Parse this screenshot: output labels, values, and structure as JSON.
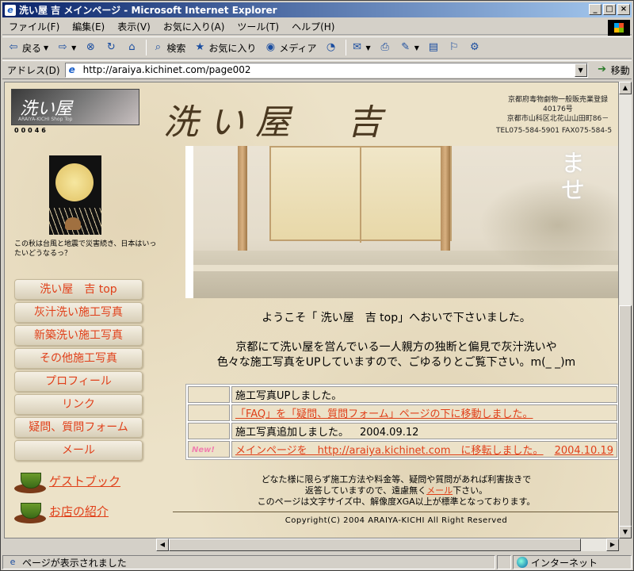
{
  "window": {
    "title": "洗い屋 吉 メインページ - Microsoft Internet Explorer",
    "controls": [
      "_",
      "□",
      "×"
    ]
  },
  "menu": [
    "ファイル(F)",
    "編集(E)",
    "表示(V)",
    "お気に入り(A)",
    "ツール(T)",
    "ヘルプ(H)"
  ],
  "toolbar": {
    "back": "戻る",
    "search": "検索",
    "favorites": "お気に入り",
    "media": "メディア"
  },
  "address": {
    "label": "アドレス(D)",
    "url": "http://araiya.kichinet.com/page002",
    "go": "移動"
  },
  "page": {
    "logo_text": "洗い屋",
    "logo_sub": "ARAIYA-KICHI  Shop Top",
    "counter": "00046",
    "title": "洗い屋　吉",
    "address_lines": [
      "京都府毒物劇物一般販売業登録",
      "40176号",
      "京都市山科区北花山山田町86－"
    ],
    "tel": "TEL075-584-5901 FAX075-584-5",
    "photo_kana": "ま\nせ",
    "moon_note": "この秋は台風と地震で災害続き、日本はいったいどうなるっ？",
    "nav": [
      "洗い屋　吉 top",
      "灰汁洗い施工写真",
      "新築洗い施工写真",
      "その他施工写真",
      "プロフィール",
      "リンク",
      "疑問、質問フォーム",
      "メール"
    ],
    "guestbook": "ゲストブック",
    "shop_intro": "お店の紹介",
    "welcome": "ようこそ「 洗い屋　吉 top」へおいで下さいました。",
    "intro_1": "京都にて洗い屋を営んでいる一人親方の独断と偏見で灰汁洗いや",
    "intro_2": "色々な施工写真をUPしていますので、ごゆるりとご覧下さい。m(_ _)m",
    "news": [
      {
        "badge": "",
        "text": "施工写真UPしました。",
        "date": "",
        "link": false
      },
      {
        "badge": "",
        "text": "「FAQ」を「疑問、質問フォーム」ページの下に移動しました。",
        "date": "",
        "link": true
      },
      {
        "badge": "",
        "text": "施工写真追加しました。",
        "date": "2004.09.12",
        "link": false
      },
      {
        "badge": "New!",
        "text": "メインページを　http://araiya.kichinet.com　に移転しました。",
        "date": "2004.10.19",
        "link": true
      }
    ],
    "footer_1": "どなた様に限らず施工方法や料金等、疑問や質問があれば利害抜きで",
    "footer_2a": "返答していますので、遠慮無く",
    "footer_mail": "メール",
    "footer_2b": "下さい。",
    "footer_3": "このページは文字サイズ中、解像度XGA以上が標準となっております。",
    "copyright": "Copyright(C) 2004 ARAIYA-KICHI All Right Reserved"
  },
  "status": {
    "text": "ページが表示されました",
    "zone": "インターネット"
  },
  "colors": {
    "link": "#e0401a",
    "titlebar": "#0a246a",
    "page_bg": "#ece2c8"
  }
}
